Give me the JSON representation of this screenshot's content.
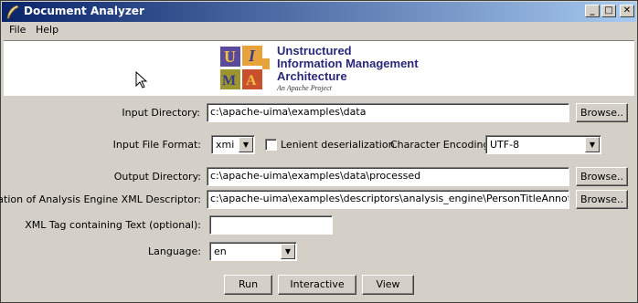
{
  "window": {
    "title": "Document Analyzer"
  },
  "menu": {
    "file": "File",
    "help": "Help"
  },
  "banner": {
    "line1": "Unstructured",
    "line2": "Information Management",
    "line3": "Architecture",
    "tagline": "An Apache Project",
    "logo_letters": [
      "U",
      "I",
      "M",
      "A"
    ]
  },
  "form": {
    "input_dir_label": "Input Directory:",
    "input_dir_value": "c:\\apache-uima\\examples\\data",
    "browse": "Browse..",
    "format_label": "Input File Format:",
    "format_value": "xmi",
    "lenient_label": "Lenient deserialization",
    "encoding_label": "Character Encoding:",
    "encoding_value": "UTF-8",
    "output_dir_label": "Output Directory:",
    "output_dir_value": "c:\\apache-uima\\examples\\data\\processed",
    "descriptor_label": "Location of Analysis Engine XML Descriptor:",
    "descriptor_value": "c:\\apache-uima\\examples\\descriptors\\analysis_engine\\PersonTitleAnnotator.xml",
    "xml_tag_label": "XML Tag containing Text (optional):",
    "xml_tag_value": "",
    "language_label": "Language:",
    "language_value": "en"
  },
  "buttons": {
    "run": "Run",
    "interactive": "Interactive",
    "view": "View"
  },
  "colors": {
    "title_start": "#0a246a",
    "title_end": "#a6caf0",
    "face": "#d4d0c8",
    "logo_text": "#2a2878"
  }
}
